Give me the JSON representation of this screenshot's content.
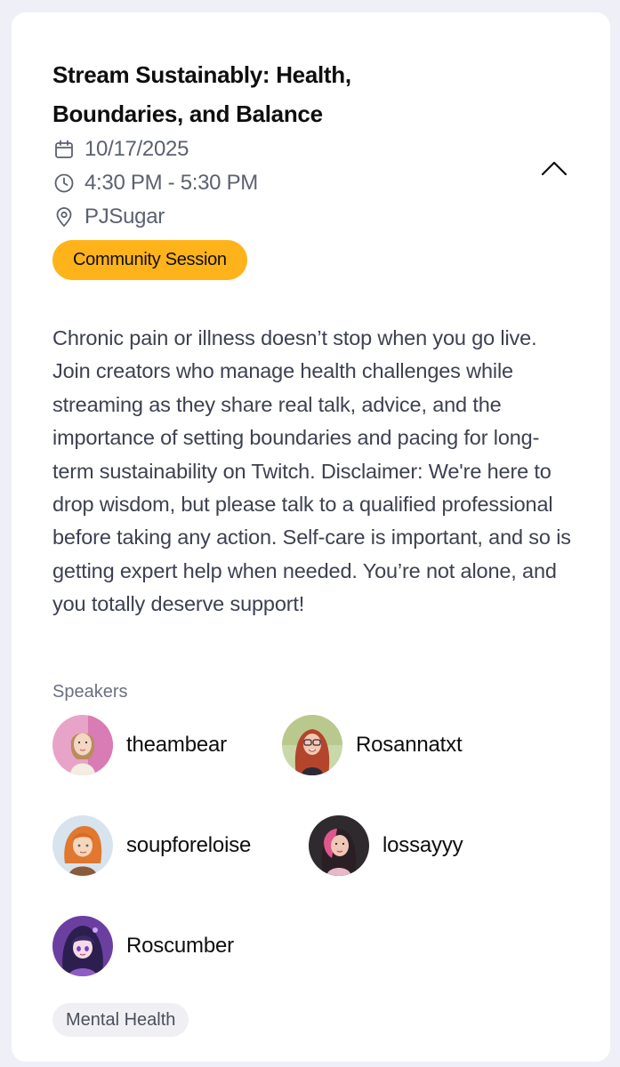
{
  "event": {
    "title": "Stream Sustainably: Health, Boundaries, and Balance",
    "date": "10/17/2025",
    "time": "4:30 PM - 5:30 PM",
    "location": "PJSugar",
    "category": "Community Session",
    "description": "Chronic pain or illness doesn’t stop when you go live. Join creators who manage health challenges while streaming as they share real talk, advice, and the importance of setting boundaries and pacing for long-term sustainability on Twitch. Disclaimer: We're here to drop wisdom, but please talk to a qualified professional before taking any action. Self-care is important, and so is getting expert help when needed. You’re not alone, and you totally deserve support!",
    "speakers_label": "Speakers",
    "speakers": [
      {
        "name": "theambear"
      },
      {
        "name": "Rosannatxt"
      },
      {
        "name": "soupforeloise"
      },
      {
        "name": "lossayyy"
      },
      {
        "name": "Roscumber"
      }
    ],
    "tags": [
      "Mental Health"
    ]
  },
  "icons": {
    "date": "calendar-icon",
    "time": "clock-icon",
    "location": "map-pin-icon",
    "toggle": "chevron-up-icon"
  },
  "colors": {
    "page_background": "#efeff8",
    "card_background": "#ffffff",
    "badge_background": "#ffb31a",
    "tag_background": "#f0f0f4",
    "meta_text": "#5c6170"
  }
}
